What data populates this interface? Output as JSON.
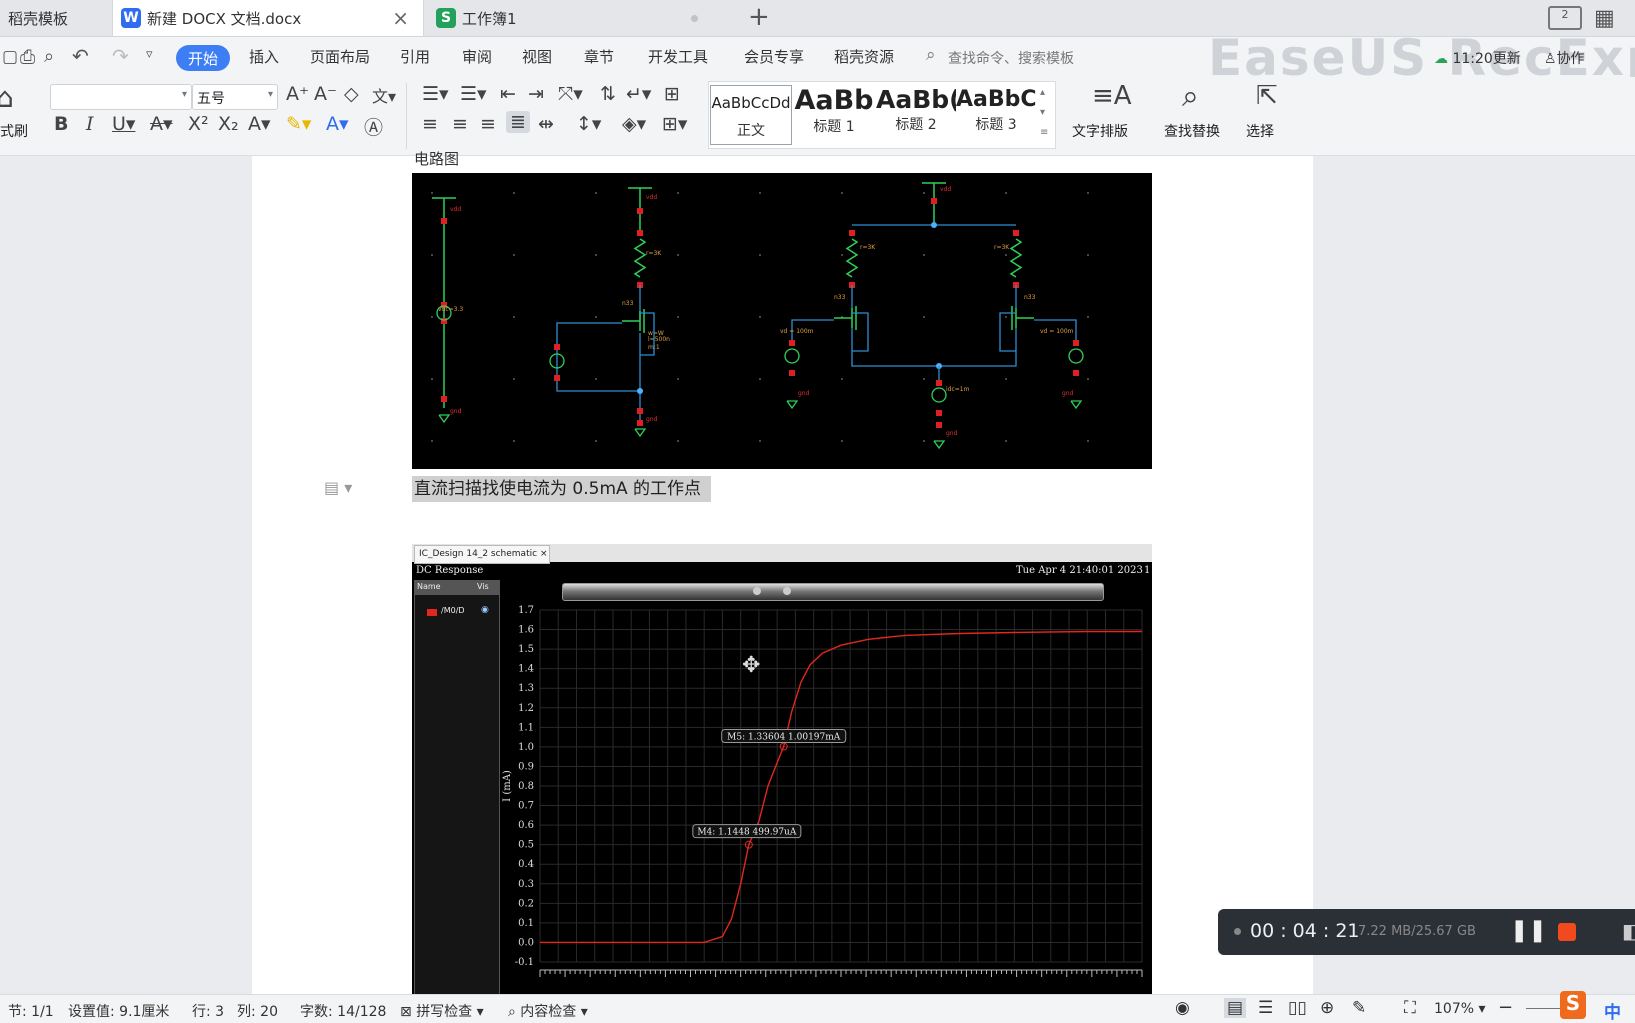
{
  "tabs": [
    {
      "label": "稻壳模板"
    },
    {
      "label": "新建 DOCX 文档.docx"
    },
    {
      "label": "工作簿1"
    }
  ],
  "menu": {
    "active": "开始",
    "items": [
      "插入",
      "页面布局",
      "引用",
      "审阅",
      "视图",
      "章节",
      "开发工具",
      "会员专享",
      "稻壳资源"
    ],
    "search_placeholder": "查找命令、搜索模板",
    "update": "11:20更新",
    "collab": "协作"
  },
  "watermark": "EaseUS RecExp",
  "ribbon": {
    "format_painter": "式刷",
    "font_size": "五号",
    "styles": [
      {
        "preview": "AaBbCcDd",
        "label": "正文"
      },
      {
        "preview": "AaBb",
        "label": "标题 1"
      },
      {
        "preview": "AaBb(",
        "label": "标题 2"
      },
      {
        "preview": "AaBbC(",
        "label": "标题 3"
      }
    ],
    "text_layout": "文字排版",
    "find_replace": "查找替换",
    "select": "选择"
  },
  "doc": {
    "heading_partial": "电路图",
    "paragraph": "直流扫描找使电流为 0.5mA 的工作点"
  },
  "schematic": {
    "labels": [
      "vdd",
      "vdc=3.3",
      "gnd",
      "vdd",
      "r=3K",
      "n33",
      "w=W",
      "l=500n",
      "m:1",
      "gnd",
      "vdd",
      "r=3K",
      "r=3K",
      "n33",
      "n33",
      "vd = 100m",
      "vd = 100m",
      "idc=1m",
      "gnd",
      "gnd",
      "gnd"
    ]
  },
  "waveform": {
    "window_tab": "IC_Design 14_2 schematic",
    "title": "DC Response",
    "timestamp": "Tue Apr 4 21:40:01 2023",
    "page_no": "1",
    "legend_headers": [
      "Name",
      "Vis"
    ],
    "signal": "/M0/D",
    "markers": [
      {
        "label": "M5: 1.33604 1.00197mA",
        "x": 1.33604,
        "y": 1.00197
      },
      {
        "label": "M4: 1.1448 499.97uA",
        "x": 1.1448,
        "y": 0.49997
      }
    ]
  },
  "chart_data": {
    "type": "line",
    "title": "DC Response",
    "ylabel": "I (mA)",
    "xlabel": "",
    "ylim": [
      -0.1,
      1.7
    ],
    "yticks": [
      "1.7",
      "1.6",
      "1.5",
      "1.4",
      "1.3",
      "1.2",
      "1.1",
      "1.0",
      "0.9",
      "0.8",
      "0.7",
      "0.6",
      "0.5",
      "0.4",
      "0.3",
      "0.2",
      "0.1",
      "0.0",
      "-0.1"
    ],
    "series": [
      {
        "name": "/M0/D",
        "color": "#e0281e",
        "x": [
          0.0,
          0.3,
          0.6,
          0.9,
          1.0,
          1.05,
          1.1,
          1.1448,
          1.2,
          1.25,
          1.3,
          1.33604,
          1.38,
          1.43,
          1.48,
          1.55,
          1.65,
          1.8,
          2.0,
          2.3,
          2.6,
          3.0,
          3.3
        ],
        "y": [
          0.0,
          0.0,
          0.0,
          0.0,
          0.03,
          0.12,
          0.3,
          0.49997,
          0.62,
          0.8,
          0.92,
          1.00197,
          1.18,
          1.33,
          1.42,
          1.48,
          1.52,
          1.55,
          1.57,
          1.58,
          1.585,
          1.59,
          1.59
        ]
      }
    ],
    "xlim": [
      0,
      3.3
    ],
    "grid": true,
    "background": "#000000"
  },
  "recorder": {
    "time": "00 : 04 : 21",
    "size": "7.22 MB/25.67 GB"
  },
  "status": {
    "section": "节: 1/1",
    "setting": "设置值: 9.1厘米",
    "row": "行: 3",
    "col": "列: 20",
    "words": "字数: 14/128",
    "spell": "拼写检查",
    "content_check": "内容检查",
    "zoom": "107%",
    "ime": "中"
  },
  "colors": {
    "accent": "#3d7ef5",
    "wps_blue": "#2f6cf0",
    "et_green": "#21a159",
    "wave": "#e0281e",
    "wire": "#2f8fd0",
    "comp": "#2fd05a",
    "node": "#e02020"
  }
}
